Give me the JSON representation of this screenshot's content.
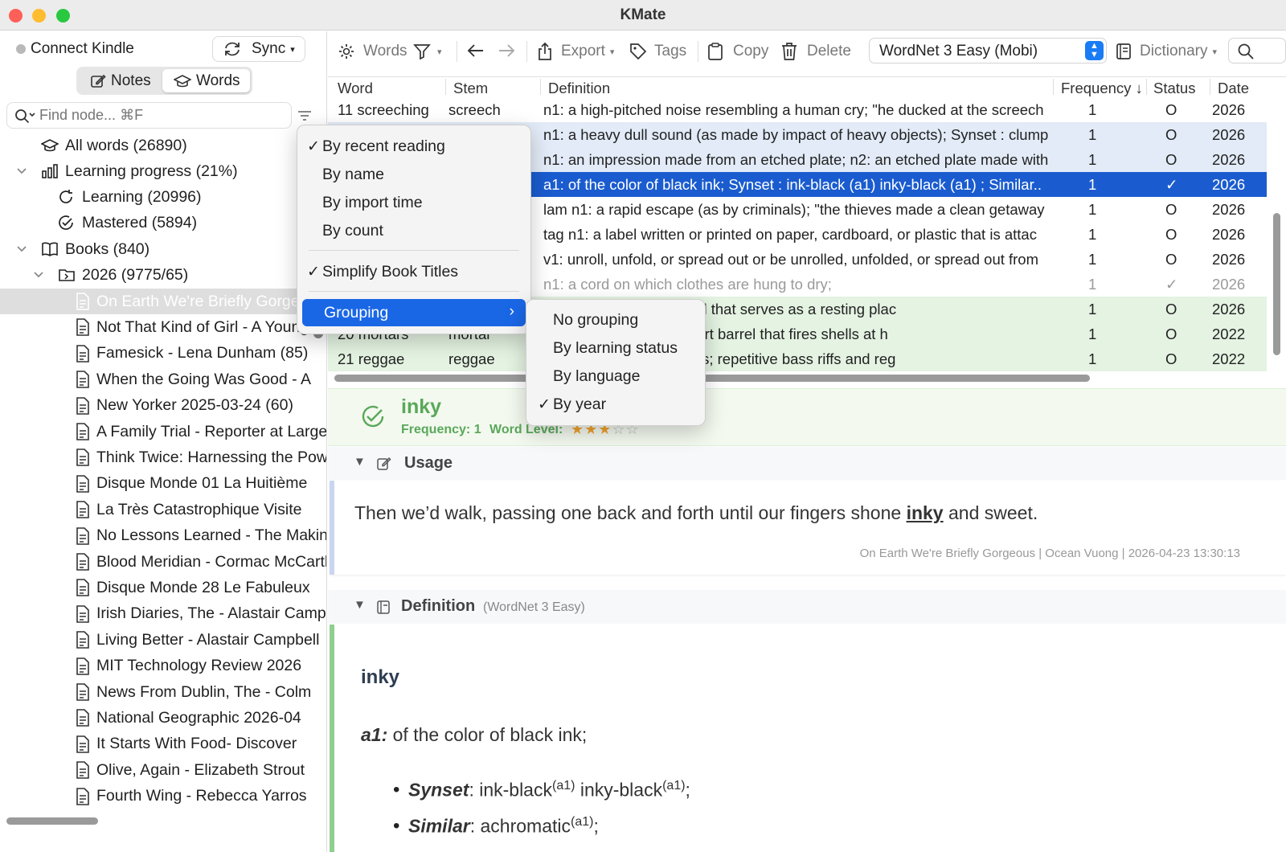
{
  "app": {
    "title": "KMate"
  },
  "colors": {
    "selection_blue": "#1a5ccf",
    "row_blue": "#e2ebf7",
    "row_green": "#e4f3e2",
    "accent_green": "#7ac37a",
    "orange_star": "#f0a22e"
  },
  "sidebar": {
    "connect": "Connect Kindle",
    "sync": "Sync",
    "tabs": [
      "Notes",
      "Words"
    ],
    "search_placeholder": "Find node... ⌘F",
    "tree": [
      {
        "label": "All words (26890)",
        "icon": "graduation-cap-icon"
      },
      {
        "label": "Learning progress (21%)",
        "icon": "bar-chart-icon"
      },
      {
        "label": "Learning (20996)",
        "icon": "refresh-icon"
      },
      {
        "label": "Mastered (5894)",
        "icon": "check-circle-icon"
      },
      {
        "label": "Books (840)",
        "icon": "book-icon"
      },
      {
        "label": "2026 (9775/65)",
        "icon": "folder-icon"
      }
    ],
    "books": [
      "On Earth We're Briefly Gorgeous",
      "Not That Kind of Girl - A Young",
      "Famesick - Lena Dunham (85)",
      "When the Going Was Good - A",
      "New Yorker 2025-03-24 (60)",
      "A Family Trial - Reporter at Large",
      "Think Twice: Harnessing the Power",
      "Disque Monde 01 La Huitième",
      "La Très Catastrophique Visite",
      "No Lessons Learned - The Making",
      "Blood Meridian - Cormac McCarthy",
      "Disque Monde 28 Le Fabuleux",
      "Irish Diaries, The - Alastair Campbell",
      "Living Better - Alastair Campbell",
      "MIT Technology Review 2026",
      "News From Dublin, The - Colm",
      "National Geographic 2026-04",
      "It Starts With Food- Discover",
      "Olive, Again - Elizabeth Strout",
      "Fourth Wing - Rebecca Yarros"
    ]
  },
  "toolbar": {
    "words": "Words",
    "export": "Export",
    "tags": "Tags",
    "copy": "Copy",
    "delete": "Delete",
    "dictionary_select": "WordNet 3 Easy (Mobi)",
    "dictionary": "Dictionary"
  },
  "table": {
    "headers": [
      "Word",
      "Stem",
      "Definition",
      "Frequency ↓",
      "Status",
      "Date"
    ],
    "rows": [
      {
        "word": "11 screeching",
        "stem": "screech",
        "def": "n1: a high-pitched noise resembling a human cry; \"he ducked at the screech",
        "freq": "1",
        "status": "O",
        "date": "2026",
        "style": "plain"
      },
      {
        "word": "",
        "stem": "",
        "def": "n1: a heavy dull sound (as made by impact of heavy objects); Synset : clump",
        "freq": "1",
        "status": "O",
        "date": "2026",
        "style": "blue"
      },
      {
        "word": "",
        "stem": "",
        "def": "n1: an impression made from an etched plate; n2: an etched plate made with",
        "freq": "1",
        "status": "O",
        "date": "2026",
        "style": "blue"
      },
      {
        "word": "",
        "stem": "",
        "def": "a1: of the color of black ink; Synset : ink-black (a1) inky-black (a1) ; Similar..",
        "freq": "1",
        "status": "✓",
        "date": "2026",
        "style": "selected"
      },
      {
        "word": "",
        "stem": "",
        "def": "lam n1: a rapid escape (as by criminals); \"the thieves made a clean getaway",
        "freq": "1",
        "status": "O",
        "date": "2026",
        "style": "plain"
      },
      {
        "word": "",
        "stem": "",
        "def": "tag n1: a label written or printed on paper, cardboard, or plastic that is attac",
        "freq": "1",
        "status": "O",
        "date": "2026",
        "style": "plain"
      },
      {
        "word": "",
        "stem": "",
        "def": "v1: unroll, unfold, or spread out or be unrolled, unfolded, or spread out from",
        "freq": "1",
        "status": "O",
        "date": "2026",
        "style": "plain"
      },
      {
        "word": "",
        "stem": "",
        "def": "n1: a cord on which clothes are hung to dry;",
        "freq": "1",
        "status": "✓",
        "date": "2026",
        "style": "muted"
      },
      {
        "word": "",
        "stem": "",
        "def": "sisting of a branch or rod that serves as a resting plac",
        "freq": "1",
        "status": "O",
        "date": "2026",
        "style": "green"
      },
      {
        "word": "20 mortars",
        "stem": "mortar",
        "def": "igh-angle gun with a short barrel that fires shells at h",
        "freq": "1",
        "status": "O",
        "date": "2022",
        "style": "green"
      },
      {
        "word": "21 reggae",
        "stem": "reggae",
        "def": "inating in the West Indies; repetitive bass riffs and reg",
        "freq": "1",
        "status": "O",
        "date": "2022",
        "style": "green"
      }
    ]
  },
  "detail": {
    "word": "inky",
    "frequency": "Frequency: 1",
    "word_level_label": "Word Level:",
    "stars": 3,
    "usage_title": "Usage",
    "usage_before": "Then we’d walk, passing one back and forth until our fingers shone ",
    "usage_word": "inky",
    "usage_after": " and sweet.",
    "usage_source": "On Earth We're Briefly Gorgeous | Ocean Vuong | 2026-04-23 13:30:13",
    "definition_title": "Definition",
    "definition_source": "(WordNet 3 Easy)",
    "headword": "inky",
    "sense_label": "a1:",
    "sense_text": "of the color of black ink;",
    "synset_label": "Synset",
    "synset_w1": "ink-black",
    "synset_w2": "inky-black",
    "sup": "(a1)",
    "similar_label": "Similar",
    "similar_w1": "achromatic"
  },
  "menu": {
    "items": [
      "By recent reading",
      "By name",
      "By import time",
      "By count"
    ],
    "simplify": "Simplify Book Titles",
    "grouping": "Grouping",
    "submenu": [
      "No grouping",
      "By learning status",
      "By language",
      "By year"
    ]
  }
}
